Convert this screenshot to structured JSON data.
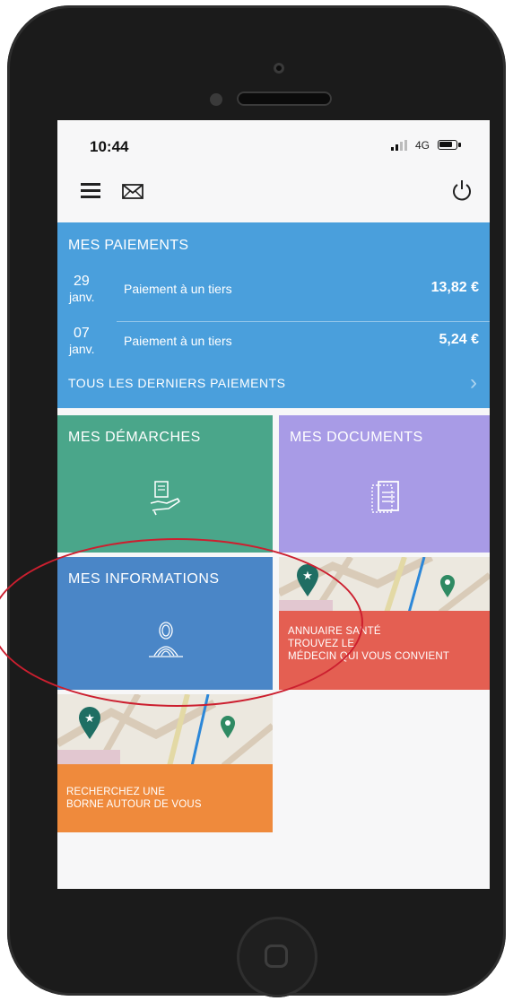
{
  "statusbar": {
    "time": "10:44",
    "network": "4G"
  },
  "payments": {
    "title": "MES PAIEMENTS",
    "items": [
      {
        "day": "29",
        "month": "janv.",
        "label": "Paiement à un tiers",
        "amount": "13,82 €"
      },
      {
        "day": "07",
        "month": "janv.",
        "label": "Paiement à un tiers",
        "amount": "5,24 €"
      }
    ],
    "all_link": "TOUS LES DERNIERS PAIEMENTS"
  },
  "tiles": {
    "demarches": "MES DÉMARCHES",
    "documents": "MES DOCUMENTS",
    "informations": "MES INFORMATIONS",
    "annuaire": {
      "line1": "ANNUAIRE SANTÉ",
      "line2": "TROUVEZ LE",
      "line3": "MÉDECIN QUI VOUS CONVIENT"
    },
    "borne": {
      "line1": "RECHERCHEZ UNE",
      "line2": "BORNE AUTOUR DE VOUS"
    }
  },
  "colors": {
    "payments": "#4a9fdc",
    "demarches": "#4aa68a",
    "documents": "#a89be6",
    "informations": "#4a86c7",
    "annuaire": "#e45f52",
    "borne": "#ef8a3c",
    "annotation_circle": "#cc1f2f"
  },
  "icons": [
    "menu-icon",
    "mail-icon",
    "power-icon",
    "hand-document-icon",
    "document-stack-icon",
    "fingerprint-person-icon",
    "map-pin-icon",
    "chevron-right-icon"
  ]
}
